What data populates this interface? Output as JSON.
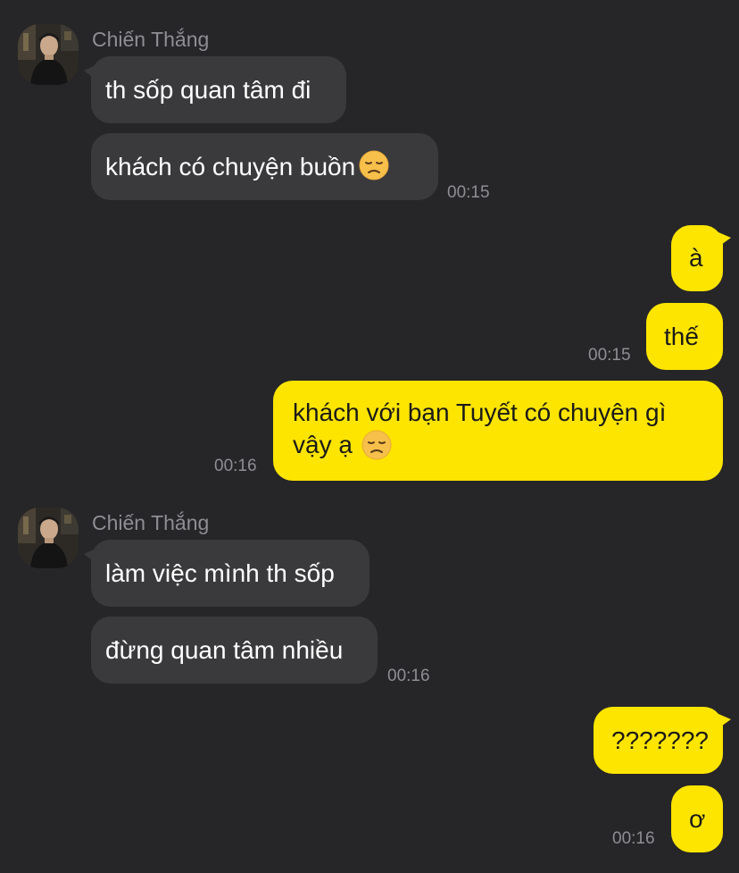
{
  "colors": {
    "background": "#262628",
    "incoming_bubble": "#3a3a3c",
    "outgoing_bubble": "#fee500",
    "meta_text": "#8e8e93"
  },
  "group1": {
    "sender": "Chiến Thắng",
    "messages": [
      "th sốp quan tâm đi",
      "khách có chuyện buồn"
    ],
    "emoji": "disappointed-face-icon",
    "time": "00:15"
  },
  "group2": {
    "messages": [
      "à",
      "thế"
    ],
    "time": "00:15"
  },
  "group3": {
    "message_line1": "khách với bạn Tuyết có chuyện gì",
    "message_line2": "vậy ạ",
    "emoji": "disappointed-face-icon",
    "time": "00:16"
  },
  "group4": {
    "sender": "Chiến Thắng",
    "messages": [
      "làm việc mình th sốp",
      "đừng quan tâm nhiều"
    ],
    "time": "00:16"
  },
  "group5": {
    "messages": [
      "???????",
      "ơ"
    ],
    "time": "00:16"
  }
}
